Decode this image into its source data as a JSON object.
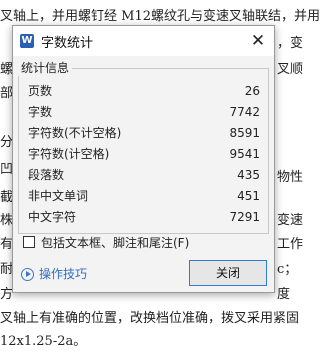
{
  "document": {
    "lines": [
      "叉轴上，并用螺钉经 M12螺纹孔与变速叉轴联结，并用",
      "叉轴上有准确的位置，改换档位准确，拨叉采用紧固",
      "12x1.25-2a。"
    ],
    "side_fragments": [
      {
        "text": "，变",
        "side": "right"
      },
      {
        "text": "叉顺",
        "side": "right"
      },
      {
        "text": "螺纹",
        "side": "left"
      },
      {
        "text": "部",
        "side": "left"
      },
      {
        "text": "分",
        "side": "left"
      },
      {
        "text": "凹",
        "side": "left"
      },
      {
        "text": "物性",
        "side": "right"
      },
      {
        "text": "截",
        "side": "left"
      },
      {
        "text": "株",
        "side": "left"
      },
      {
        "text": "变速",
        "side": "right"
      },
      {
        "text": "有",
        "side": "left"
      },
      {
        "text": "工作",
        "side": "right"
      },
      {
        "text": "耐",
        "side": "left"
      },
      {
        "text": "c；",
        "side": "right"
      },
      {
        "text": "方",
        "side": "left"
      },
      {
        "text": "度",
        "side": "right"
      }
    ]
  },
  "dialog": {
    "title": "字数统计",
    "app_icon_letter": "W",
    "close_glyph": "✕",
    "group_title": "统计信息",
    "stats": [
      {
        "label": "页数",
        "value": "26"
      },
      {
        "label": "字数",
        "value": "7742"
      },
      {
        "label": "字符数(不计空格)",
        "value": "8591"
      },
      {
        "label": "字符数(计空格)",
        "value": "9541"
      },
      {
        "label": "段落数",
        "value": "435"
      },
      {
        "label": "非中文单词",
        "value": "451"
      },
      {
        "label": "中文字符",
        "value": "7291"
      }
    ],
    "checkbox_label": "包括文本框、脚注和尾注(F)",
    "checkbox_checked": false,
    "tips_label": "操作技巧",
    "close_button_label": "关闭",
    "accent_color": "#2f7cd8"
  }
}
